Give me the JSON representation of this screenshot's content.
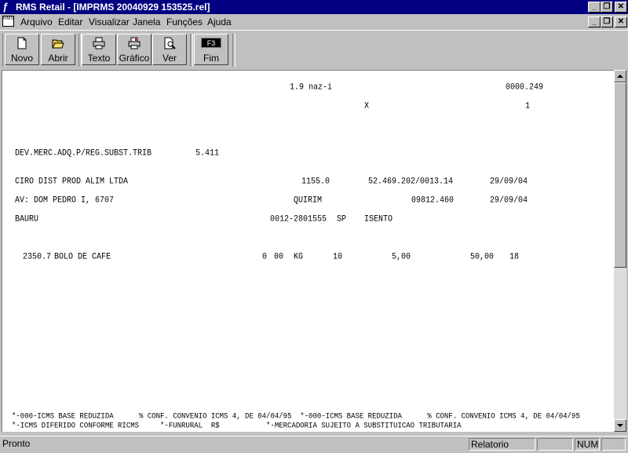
{
  "window": {
    "title": "RMS Retail - [IMPRMS 20040929 153525.rel]"
  },
  "menu": {
    "items": [
      "Arquivo",
      "Editar",
      "Visualizar",
      "Janela",
      "Funções",
      "Ajuda"
    ]
  },
  "toolbar": {
    "buttons": [
      {
        "label": "Novo",
        "icon": "new-document-icon"
      },
      {
        "label": "Abrir",
        "icon": "open-folder-icon"
      },
      {
        "label": "Texto",
        "icon": "print-icon"
      },
      {
        "label": "Gráfico",
        "icon": "print-graphic-icon"
      },
      {
        "label": "Ver",
        "icon": "preview-icon"
      },
      {
        "label": "Fim",
        "icon": "f3-key-icon",
        "key": "F3"
      }
    ]
  },
  "report": {
    "header_code": "1.9 naz-i",
    "header_number": "0000.249",
    "header_mark": "X",
    "header_page": "1",
    "operation": "DEV.MERC.ADQ.P/REG.SUBST.TRIB",
    "cfop": "5.411",
    "company": "CIRO DIST PROD ALIM LTDA",
    "company_code": "1155.0",
    "cnpj": "52.469.202/0013.14",
    "date1": "29/09/04",
    "address": "AV: DOM PEDRO I, 6707",
    "district": "QUIRIM",
    "cep": "09812.460",
    "date2": "29/09/04",
    "city": "BAURU",
    "phone": "0012-2801555",
    "state": "SP",
    "ie": "ISENTO",
    "item": {
      "code": "2350.7",
      "description": "BOLO DE CAFE",
      "cst1": "0",
      "cst2": "00",
      "unit": "KG",
      "qty": "10",
      "unit_price": "5,00",
      "total": "50,00",
      "icms_rate": "18"
    },
    "footer_line1": "*-000-ICMS BASE REDUZIDA      % CONF. CONVENIO ICMS 4, DE 04/04/95  *-000-ICMS BASE REDUZIDA      % CONF. CONVENIO ICMS 4, DE 04/04/95",
    "footer_line2": "*-ICMS DIFERIDO CONFORME RICMS     *-FUNRURAL  R$           *-MERCADORIA SUJEITO A SUBSTITUICAO TRIBUTARIA"
  },
  "status": {
    "text": "Pronto",
    "mode": "Relatorio",
    "num": "NUM"
  }
}
